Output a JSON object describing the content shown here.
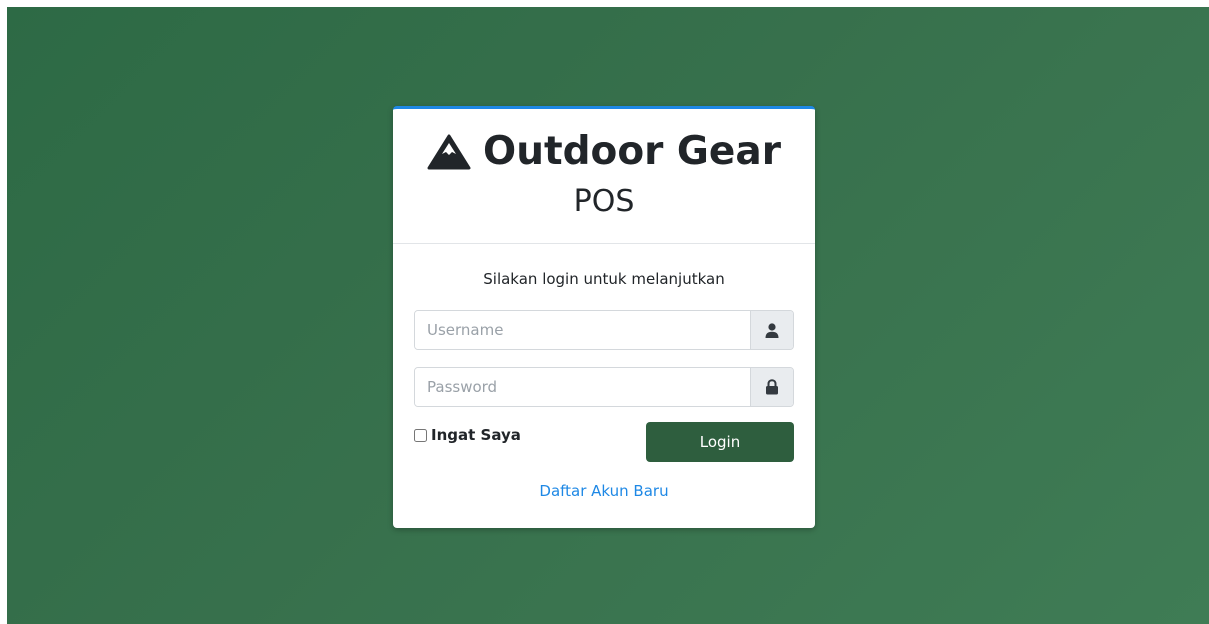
{
  "brand": {
    "title_line1": "Outdoor Gear",
    "title_line2": "POS",
    "icon": "mountain-icon"
  },
  "login": {
    "subtitle": "Silakan login untuk melanjutkan",
    "username_placeholder": "Username",
    "username_value": "",
    "username_icon": "user-icon",
    "password_placeholder": "Password",
    "password_value": "",
    "password_icon": "lock-icon",
    "remember_label": "Ingat Saya",
    "remember_checked": false,
    "submit_label": "Login",
    "register_link": "Daftar Akun Baru"
  },
  "colors": {
    "background": "#37704c",
    "card_top_border": "#1e88e5",
    "button": "#2e5e3e",
    "link": "#1e88e5"
  }
}
